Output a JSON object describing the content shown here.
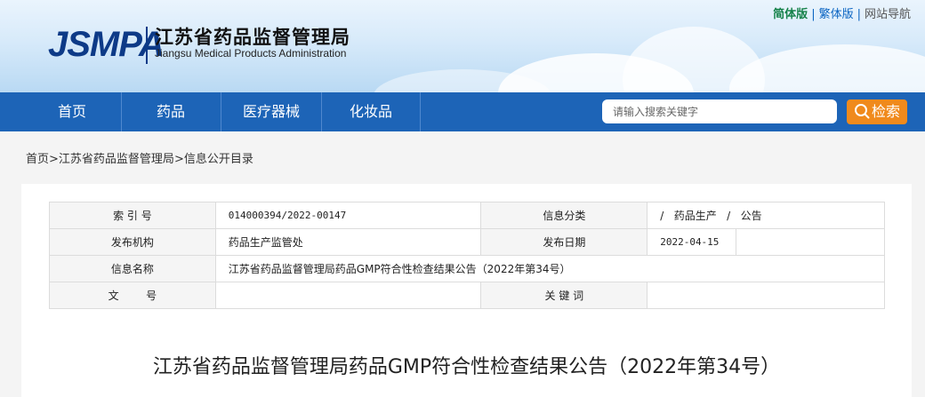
{
  "header": {
    "logo_mark": "JSMPA",
    "name_cn": "江苏省药品监督管理局",
    "name_en": "Jiangsu Medical Products Administration",
    "top_links": [
      "简体版",
      "繁体版",
      "网站导航"
    ],
    "top_link_separator": "|"
  },
  "nav": {
    "items": [
      "首页",
      "药品",
      "医疗器械",
      "化妆品"
    ],
    "search_placeholder": "请输入搜索关键字",
    "search_button": "检索"
  },
  "breadcrumb": {
    "items": [
      "首页",
      "江苏省药品监督管理局",
      "信息公开目录"
    ],
    "separator": ">"
  },
  "meta_table": {
    "index_label": "索 引 号",
    "index_value": "014000394/2022-00147",
    "category_label": "信息分类",
    "category_value": "/   药品生产   /   公告",
    "issuer_label": "发布机构",
    "issuer_value": "药品生产监管处",
    "date_label": "发布日期",
    "date_value": "2022-04-15",
    "name_label": "信息名称",
    "name_value": "江苏省药品监督管理局药品GMP符合性检查结果公告（2022年第34号）",
    "doc_no_label": "文        号",
    "doc_no_value": "",
    "keywords_label": "关 键 词",
    "keywords_value": ""
  },
  "article": {
    "title": "江苏省药品监督管理局药品GMP符合性检查结果公告（2022年第34号）"
  },
  "colors": {
    "nav_bg": "#1d64b7",
    "search_button_bg": "#f08a1c",
    "logo_blue": "#0d3a87",
    "simplified_green": "#16824a",
    "traditional_blue": "#0a64c2"
  },
  "icons": [
    "search-icon"
  ]
}
